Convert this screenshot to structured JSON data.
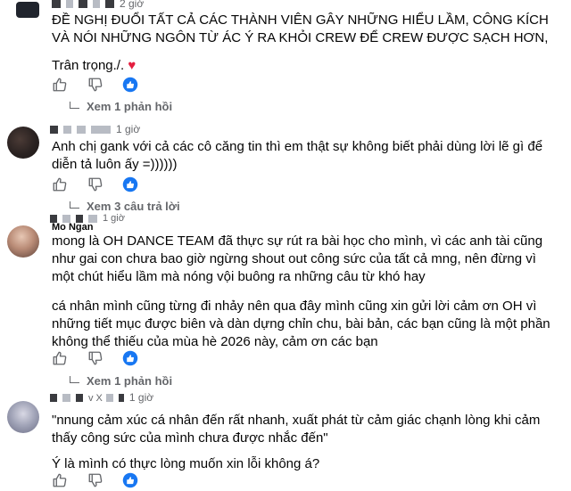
{
  "comments": [
    {
      "time": "2 giờ",
      "paragraphs": [
        "ĐỀ NGHỊ ĐUỔI TẤT CẢ CÁC THÀNH VIÊN GÂY NHỮNG HIỂU LẦM, CÔNG KÍCH VÀ NÓI NHỮNG NGÔN TỪ ÁC Ý RA KHỎI CREW ĐỂ CREW ĐƯỢC SẠCH HƠN,",
        "Trân trọng./."
      ],
      "heart": "♥",
      "reply_link": "Xem 1 phản hồi"
    },
    {
      "time": "1 giờ",
      "paragraphs": [
        "Anh chị gank với cả các cô căng tin thì em thật sự không biết phải dùng lời lẽ gì để diễn tả luôn ấy =))))))"
      ],
      "reply_link": "Xem 3 câu trả lời"
    },
    {
      "name": "Mo Ngan",
      "time": "1 giờ",
      "paragraphs": [
        "mong là OH DANCE TEAM đã thực sự rút ra bài học cho mình, vì các anh tài cũng như gai con chưa bao giờ ngừng shout out công sức của tất cả mng, nên đừng vì một chút hiểu lầm mà nóng vội buông ra những câu từ khó hay",
        "cá nhân mình cũng từng đi nhảy nên qua đây mình cũng xin gửi lời cảm ơn OH vì những tiết mục được biên và dàn dựng chỉn chu, bài bản, các bạn cũng là một phần không thể thiếu của mùa hè 2026 này, cảm ơn các bạn"
      ],
      "reply_link": "Xem 1 phản hồi"
    },
    {
      "name": "v X",
      "time": "1 giờ",
      "paragraphs": [
        "\"nnung cảm xúc cá nhân đến rất nhanh, xuất phát từ cảm giác chạnh lòng khi cảm thấy công sức của mình chưa được nhắc đến\"",
        "Ý là mình có thực lòng muốn xin lỗi không á?"
      ]
    }
  ],
  "icons": {
    "like": "thumbs-up-icon",
    "dislike": "thumbs-down-icon",
    "react": "like-reaction-icon"
  },
  "colors": {
    "react_blue": "#1877f2",
    "heart": "#e41e3f",
    "meta": "#65676b"
  }
}
